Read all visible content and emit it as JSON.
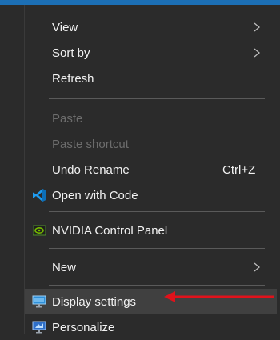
{
  "menu": {
    "items": [
      {
        "label": "View"
      },
      {
        "label": "Sort by"
      },
      {
        "label": "Refresh"
      },
      {
        "label": "Paste"
      },
      {
        "label": "Paste shortcut"
      },
      {
        "label": "Undo Rename",
        "shortcut": "Ctrl+Z"
      },
      {
        "label": "Open with Code",
        "icon": "vscode-icon"
      },
      {
        "label": "NVIDIA Control Panel",
        "icon": "nvidia-icon"
      },
      {
        "label": "New"
      },
      {
        "label": "Display settings",
        "icon": "display-icon"
      },
      {
        "label": "Personalize",
        "icon": "personalize-icon"
      }
    ]
  },
  "colors": {
    "menu_bg": "#2b2b2b",
    "text": "#f2f2f2",
    "disabled_text": "#6d6d6d",
    "highlight_bg": "#404040",
    "annotation_arrow": "#e0121b"
  }
}
